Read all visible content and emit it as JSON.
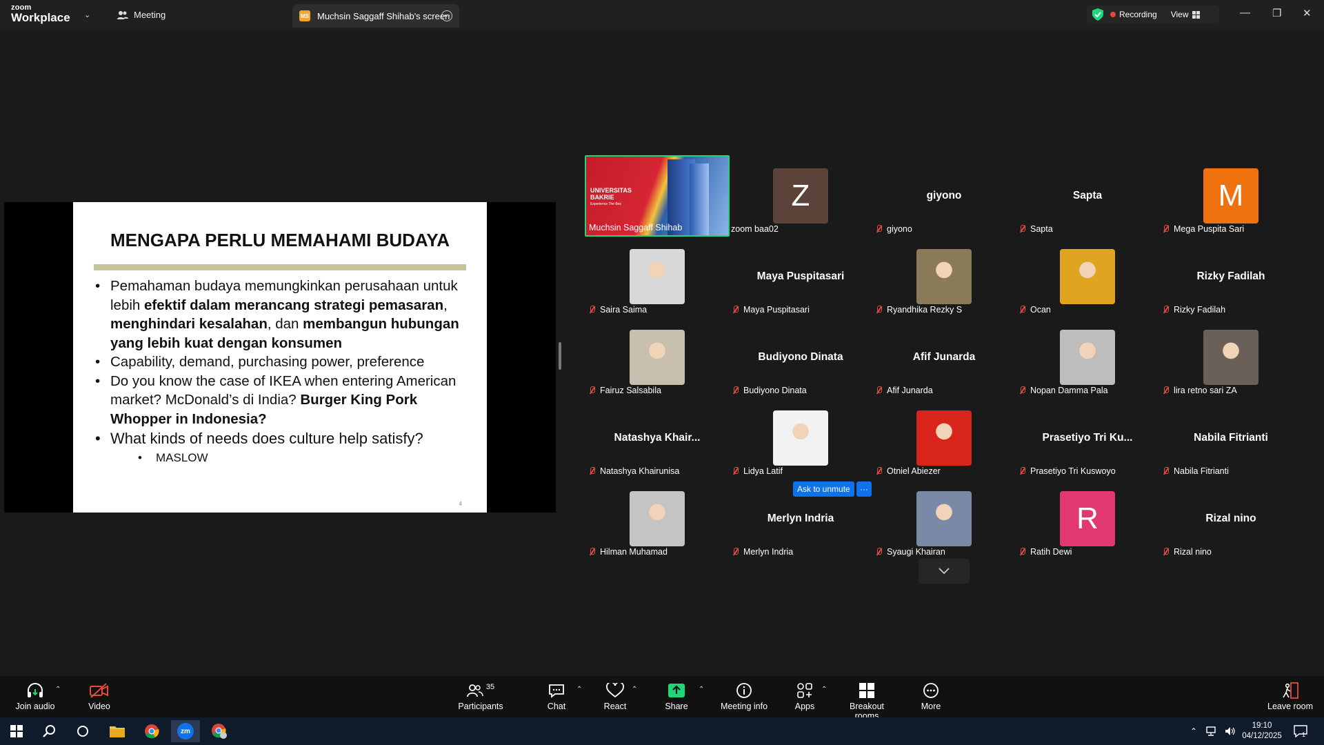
{
  "titlebar": {
    "logo_top": "zoom",
    "logo_bottom": "Workplace",
    "meeting_tab": "Meeting",
    "share_tab_badge": "MS",
    "share_tab": "Muchsin Saggaff Shihab's screen",
    "recording": "Recording",
    "view": "View"
  },
  "slide": {
    "title": "MENGAPA PERLU MEMAHAMI BUDAYA",
    "page": "4",
    "b1_a": "Pemahaman budaya memungkinkan perusahaan untuk lebih ",
    "b1_b": "efektif dalam merancang strategi pemasaran",
    "b1_c": ", ",
    "b1_d": "menghindari kesalahan",
    "b1_e": ", dan ",
    "b1_f": "membangun hubungan yang lebih kuat dengan konsumen",
    "b2": "Capability, demand, purchasing power, preference",
    "b3_a": "Do you know the case of IKEA when entering American market? McDonald’s di India? ",
    "b3_b": "Burger King Pork Whopper in Indonesia?",
    "b4": "What kinds of needs does culture help satisfy?",
    "b5": "MASLOW"
  },
  "participants": [
    {
      "label": "Muchsin Saggaff Shihab",
      "center": "",
      "avatar": "video",
      "muted": false
    },
    {
      "label": "zoom baa02",
      "center": "",
      "avatar": "letter",
      "letter": "Z",
      "color": "#5b4339",
      "muted": false
    },
    {
      "label": "giyono",
      "center": "giyono",
      "avatar": "none",
      "muted": true
    },
    {
      "label": "Sapta",
      "center": "Sapta",
      "avatar": "none",
      "muted": true
    },
    {
      "label": "Mega Puspita Sari",
      "center": "",
      "avatar": "letter",
      "letter": "M",
      "color": "#f0720e",
      "muted": true
    },
    {
      "label": "Saira Saima",
      "center": "",
      "avatar": "photo",
      "color": "#d8d8d8",
      "muted": true
    },
    {
      "label": "Maya Puspitasari",
      "center": "Maya Puspitasari",
      "avatar": "none",
      "muted": true
    },
    {
      "label": "Ryandhika Rezky S",
      "center": "",
      "avatar": "photo",
      "color": "#8a7a5a",
      "muted": true
    },
    {
      "label": "Ocan",
      "center": "",
      "avatar": "photo",
      "color": "#e0a520",
      "muted": true
    },
    {
      "label": "Rizky Fadilah",
      "center": "Rizky Fadilah",
      "avatar": "none",
      "muted": true
    },
    {
      "label": "Fairuz Salsabila",
      "center": "",
      "avatar": "photo",
      "color": "#c9bfae",
      "muted": true
    },
    {
      "label": "Budiyono Dinata",
      "center": "Budiyono Dinata",
      "avatar": "none",
      "muted": true
    },
    {
      "label": "Afif Junarda",
      "center": "Afif Junarda",
      "avatar": "none",
      "muted": true
    },
    {
      "label": "Nopan Damma Pala",
      "center": "",
      "avatar": "photo",
      "color": "#bdbdbd",
      "muted": true
    },
    {
      "label": "lira retno sari ZA",
      "center": "",
      "avatar": "photo",
      "color": "#6a6058",
      "muted": true
    },
    {
      "label": "Natashya Khairunisa",
      "center": "Natashya  Khair...",
      "avatar": "none",
      "muted": true
    },
    {
      "label": "Lidya Latif",
      "center": "",
      "avatar": "photo",
      "color": "#f2f2f2",
      "muted": true
    },
    {
      "label": "Otniel Abiezer",
      "center": "",
      "avatar": "photo",
      "color": "#d9241c",
      "muted": true
    },
    {
      "label": "Prasetiyo Tri Kuswoyo",
      "center": "Prasetiyo  Tri  Ku...",
      "avatar": "none",
      "muted": true
    },
    {
      "label": "Nabila Fitrianti",
      "center": "Nabila Fitrianti",
      "avatar": "none",
      "muted": true
    },
    {
      "label": "Hilman Muhamad",
      "center": "",
      "avatar": "photo",
      "color": "#c4c4c4",
      "muted": true
    },
    {
      "label": "Merlyn Indria",
      "center": "Merlyn Indria",
      "avatar": "none",
      "muted": true
    },
    {
      "label": "Syaugi Khairan",
      "center": "",
      "avatar": "photo",
      "color": "#7a8aa6",
      "muted": true
    },
    {
      "label": "Ratih Dewi",
      "center": "",
      "avatar": "letter",
      "letter": "R",
      "color": "#e3386f",
      "muted": true
    },
    {
      "label": "Rizal nino",
      "center": "Rizal nino",
      "avatar": "none",
      "muted": true
    }
  ],
  "video_tile_text": {
    "line1": "UNIVERSITAS",
    "line2": "BAKRIE",
    "line3": "Experience The Bes"
  },
  "ask_unmute": "Ask to unmute",
  "ask_more": "···",
  "toolbar": {
    "join_audio": "Join audio",
    "video": "Video",
    "participants": "Participants",
    "participants_count": "35",
    "chat": "Chat",
    "react": "React",
    "share": "Share",
    "meeting_info": "Meeting info",
    "apps": "Apps",
    "breakout": "Breakout rooms",
    "more": "More",
    "leave": "Leave room"
  },
  "taskbar": {
    "zoom_icon": "zm",
    "time": "19:10",
    "date": "04/12/2025",
    "notif_count": "1"
  },
  "colors": {
    "speaker_border": "#1dd77a",
    "share_green": "#1dd77a",
    "accent_blue": "#0e72ed",
    "muted_red": "#e84b3c"
  }
}
